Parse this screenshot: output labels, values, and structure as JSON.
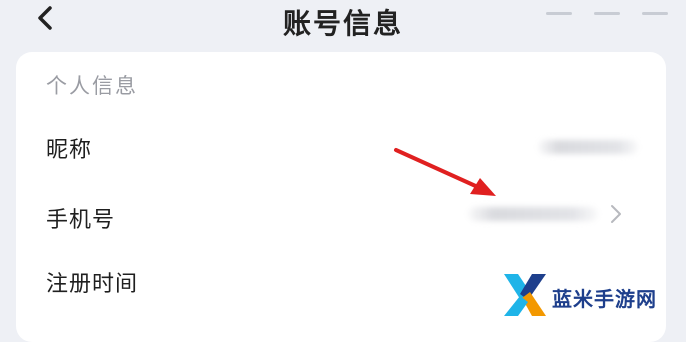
{
  "header": {
    "title": "账号信息",
    "back_icon": "chevron-left-icon"
  },
  "card": {
    "section_title": "个人信息",
    "rows": [
      {
        "label": "昵称"
      },
      {
        "label": "手机号"
      },
      {
        "label": "注册时间"
      }
    ]
  },
  "watermark": {
    "text": "蓝米手游网",
    "colors": {
      "blue": "#1e3f8c",
      "accent": "#1fb4e8",
      "orange": "#f39800"
    }
  },
  "colors": {
    "arrow": "#e02020",
    "background": "#eef0f5"
  }
}
